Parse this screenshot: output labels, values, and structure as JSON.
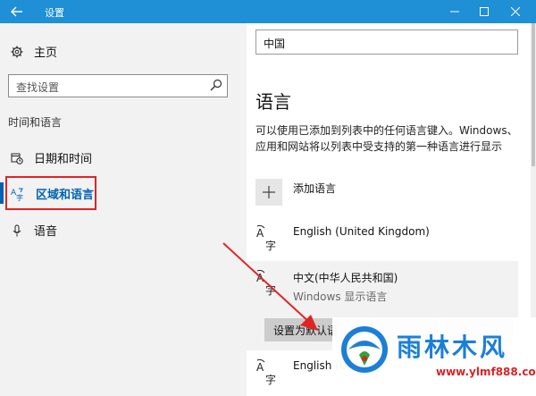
{
  "window": {
    "title": "设置",
    "back_icon": "back-arrow-icon",
    "controls": [
      "minimize-icon",
      "maximize-icon",
      "close-icon"
    ]
  },
  "sidebar": {
    "home_label": "主页",
    "search_placeholder": "查找设置",
    "section_label": "时间和语言",
    "items": [
      {
        "label": "日期和时间",
        "icon": "calendar-clock-icon",
        "active": false
      },
      {
        "label": "区域和语言",
        "icon": "region-language-icon",
        "active": true
      },
      {
        "label": "语音",
        "icon": "microphone-icon",
        "active": false
      }
    ]
  },
  "main": {
    "country_value": "中国",
    "section_title": "语言",
    "description": "可以使用已添加到列表中的任何语言键入。Windows、应用和网站将以列表中受支持的第一种语言进行显示",
    "add_language_label": "添加语言",
    "languages": [
      {
        "name": "English (United Kingdom)",
        "sub": ""
      },
      {
        "name": "中文(中华人民共和国)",
        "sub": "Windows 显示语言"
      },
      {
        "name": "English (U",
        "sub": ""
      }
    ],
    "buttons": {
      "set_default": "设置为默认语",
      "options": "",
      "remove": ""
    }
  },
  "watermark": {
    "brand": "雨林木风",
    "url": "www.ylmf888.com"
  },
  "colors": {
    "titlebar": "#1f8fd6",
    "accent": "#0063b1",
    "highlight_box": "#e02424",
    "arrow": "#e02424"
  }
}
